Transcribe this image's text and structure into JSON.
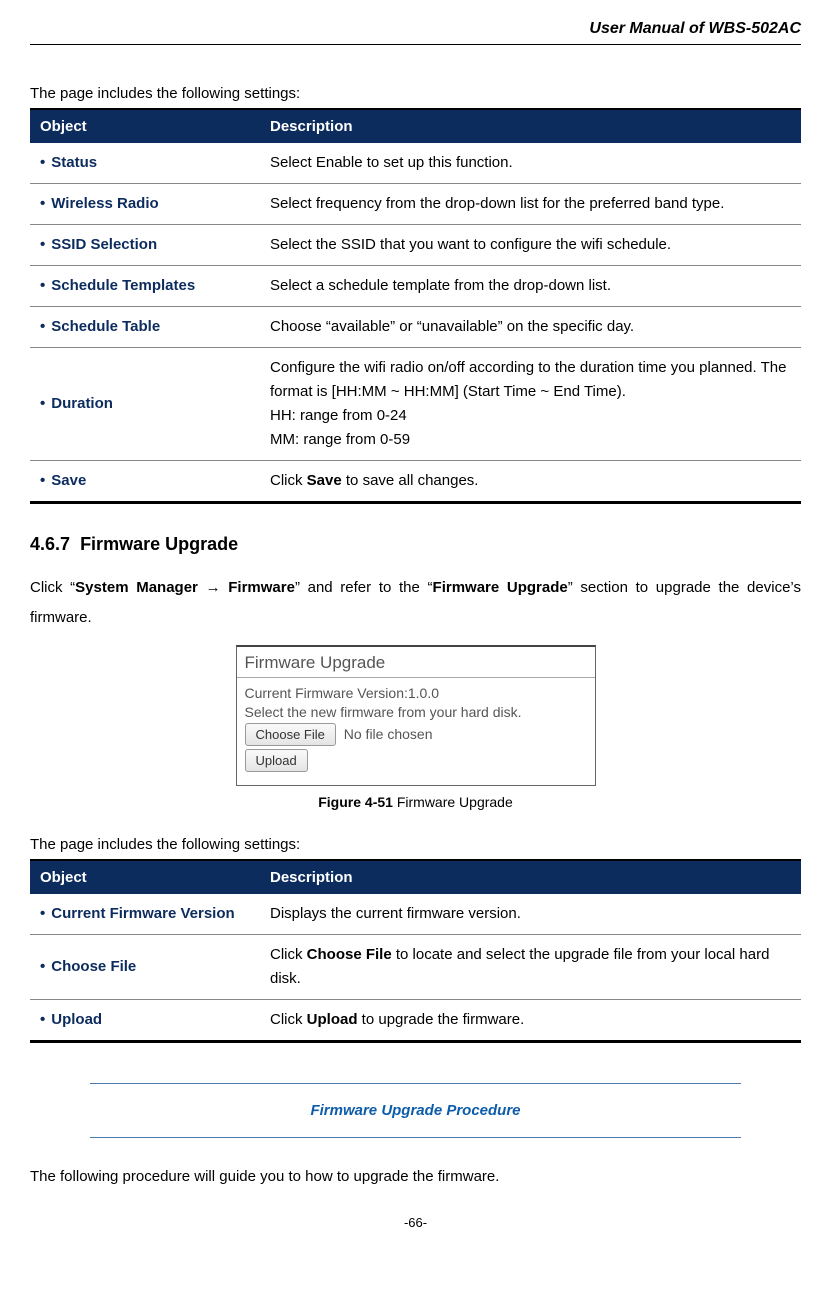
{
  "header": {
    "title": "User Manual of WBS-502AC"
  },
  "intro1": "The page includes the following settings:",
  "table1": {
    "head": {
      "object": "Object",
      "description": "Description"
    },
    "rows": [
      {
        "object": "Status",
        "description": "Select Enable to set up this function."
      },
      {
        "object": "Wireless Radio",
        "description": "Select frequency from the drop-down list for the preferred band type."
      },
      {
        "object": "SSID Selection",
        "description": "Select the SSID that you want to configure the wifi schedule."
      },
      {
        "object": "Schedule Templates",
        "description": "Select a schedule template from the drop-down list."
      },
      {
        "object": "Schedule Table",
        "description": "Choose “available” or “unavailable” on the specific day."
      },
      {
        "object": "Duration",
        "description": "Configure the wifi radio on/off according to the duration time you planned. The format is [HH:MM ~ HH:MM] (Start Time ~ End Time).\nHH: range from 0-24\nMM: range from 0-59"
      },
      {
        "object": "Save",
        "description_prefix": "Click ",
        "description_bold": "Save",
        "description_suffix": " to save all changes."
      }
    ]
  },
  "section": {
    "number": "4.6.7",
    "title": "Firmware Upgrade"
  },
  "paragraph1": {
    "p1": "Click “",
    "b1": "System Manager → Firmware",
    "p2": "” and refer to the “",
    "b2": "Firmware Upgrade",
    "p3": "” section to upgrade the device’s firmware."
  },
  "figure": {
    "panel_title": "Firmware Upgrade",
    "version_line": "Current Firmware Version:1.0.0",
    "select_line": "Select the new firmware from your hard disk.",
    "choose_file_label": "Choose File",
    "no_file_text": "No file chosen",
    "upload_label": "Upload",
    "caption_bold": "Figure 4-51",
    "caption_rest": " Firmware Upgrade"
  },
  "intro2": "The page includes the following settings:",
  "table2": {
    "head": {
      "object": "Object",
      "description": "Description"
    },
    "rows": [
      {
        "object": "Current Firmware Version",
        "description": "Displays the current firmware version."
      },
      {
        "object": "Choose File",
        "description_prefix": "Click ",
        "description_bold": "Choose File",
        "description_suffix": " to locate and select the upgrade file from your local hard disk."
      },
      {
        "object": "Upload",
        "description_prefix": "Click ",
        "description_bold": "Upload",
        "description_suffix": " to upgrade the firmware."
      }
    ]
  },
  "procedure": {
    "title": "Firmware Upgrade Procedure"
  },
  "closing": "The following procedure will guide you to how to upgrade the firmware.",
  "page_number": "-66-"
}
